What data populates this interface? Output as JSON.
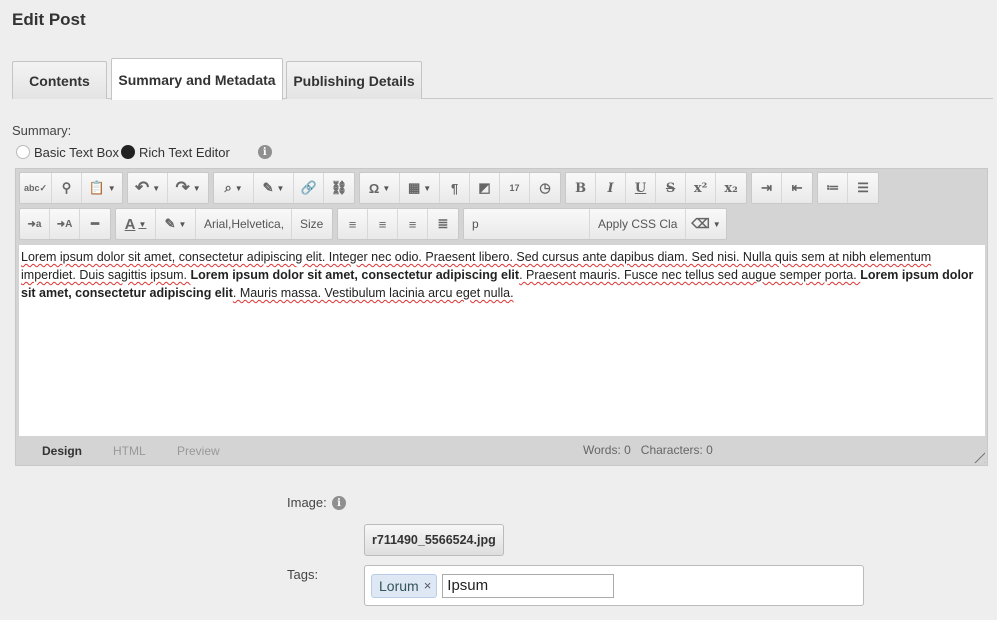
{
  "page": {
    "title": "Edit Post"
  },
  "tabs": [
    {
      "label": "Contents",
      "active": false
    },
    {
      "label": "Summary and Metadata",
      "active": true
    },
    {
      "label": "Publishing Details",
      "active": false
    }
  ],
  "summary": {
    "label": "Summary:",
    "options": [
      {
        "label": "Basic Text Box",
        "selected": false
      },
      {
        "label": "Rich Text Editor",
        "selected": true
      }
    ],
    "info_icon": "i"
  },
  "editor": {
    "toolbar": {
      "font_family": "Arial,Helvetica,",
      "font_size": "Size",
      "paragraph_format": "p",
      "css_class": "Apply CSS Cla",
      "glyphs": {
        "spellcheck": "abc✓",
        "find": "⚲",
        "paste": "📋",
        "undo": "↶",
        "redo": "↷",
        "attach": "⌕",
        "edit": "✎",
        "link": "🔗",
        "unlink": "⛓",
        "symbol": "Ω",
        "table": "▦",
        "paragraph": "¶",
        "media": "◩",
        "date": "17",
        "time": "◷",
        "bold": "B",
        "italic": "I",
        "underline": "U",
        "strike": "S",
        "superscript": "x²",
        "subscript": "x₂",
        "indent": "⇥",
        "outdent": "⇤",
        "ordered_list": "≔",
        "unordered_list": "☰",
        "lowercase": "➜a",
        "uppercase": "➜A",
        "hr": "━",
        "font_color": "A",
        "highlight": "✎",
        "align_left": "≡",
        "align_center": "≡",
        "align_right": "≡",
        "justify": "≣",
        "eraser": "⌫",
        "dropdown": "▼"
      }
    },
    "content": {
      "s1": "Lorem ipsum dolor sit amet, consectetur adipiscing elit. Integer nec odio. Praesent libero. Sed cursus ante dapibus diam. Sed nisi. Nulla quis sem at nibh elementum imperdiet. Duis sagittis ipsum. ",
      "b1": "Lorem ipsum dolor sit amet, consectetur adipiscing elit",
      "s2": ". Praesent mauris. Fusce nec tellus sed augue semper porta. ",
      "b2": "Lorem ipsum dolor sit amet, consectetur adipiscing elit",
      "s3": ". Mauris massa. Vestibulum lacinia arcu eget nulla."
    },
    "modes": {
      "design": "Design",
      "html": "HTML",
      "preview": "Preview"
    },
    "counts": "Words: 0   Characters: 0"
  },
  "image": {
    "label": "Image:",
    "info_icon": "i",
    "filename": "r711490_5566524.jpg"
  },
  "tags": {
    "label": "Tags:",
    "items": [
      {
        "label": "Lorum",
        "remove": "×"
      }
    ],
    "input_value": "Ipsum"
  }
}
